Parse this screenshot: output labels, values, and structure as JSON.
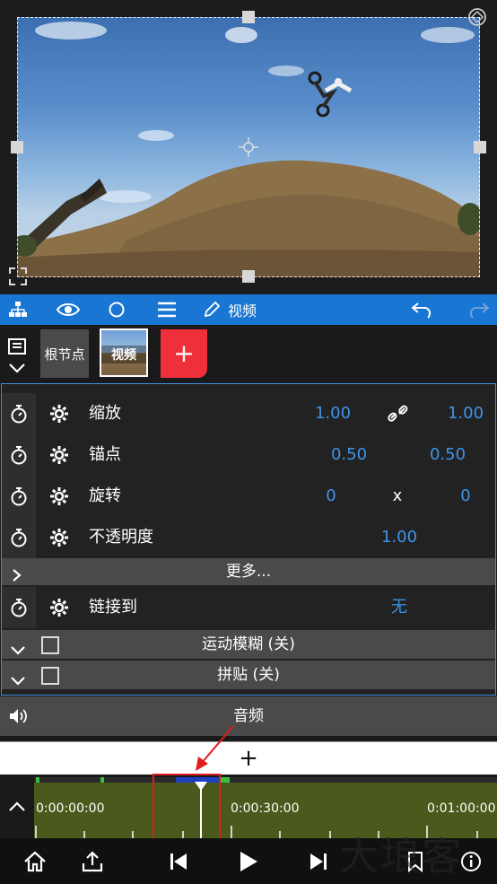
{
  "toolbar": {
    "items": [
      {
        "name": "hierarchy"
      },
      {
        "name": "eye"
      },
      {
        "name": "circle"
      },
      {
        "name": "menu"
      }
    ],
    "title": "视频"
  },
  "nodes": {
    "root_label": "根节点",
    "video_label": "视频",
    "add_label": "+"
  },
  "properties": [
    {
      "label": "缩放",
      "values": [
        "1.00",
        "1.00"
      ],
      "linked": true
    },
    {
      "label": "锚点",
      "values": [
        "0.50",
        "0.50"
      ]
    },
    {
      "label": "旋转",
      "values": [
        "0",
        "x",
        "0"
      ]
    },
    {
      "label": "不透明度",
      "values": [
        "1.00"
      ]
    }
  ],
  "more_label": "更多...",
  "link_to": {
    "label": "链接到",
    "value": "无"
  },
  "sections": [
    {
      "label": "运动模糊 (关)"
    },
    {
      "label": "拼贴 (关)"
    }
  ],
  "audio_label": "音频",
  "add_track_label": "+",
  "timeline": {
    "timecodes": [
      "0:00:00:00",
      "0:00:30:00",
      "0:01:00:00"
    ]
  },
  "watermark": "大埌客",
  "colors": {
    "accent": "#1976d2",
    "value": "#3d94ea",
    "track": "#4a5a1c",
    "add": "#ef2f3a",
    "highlight": "#e01b1b"
  }
}
